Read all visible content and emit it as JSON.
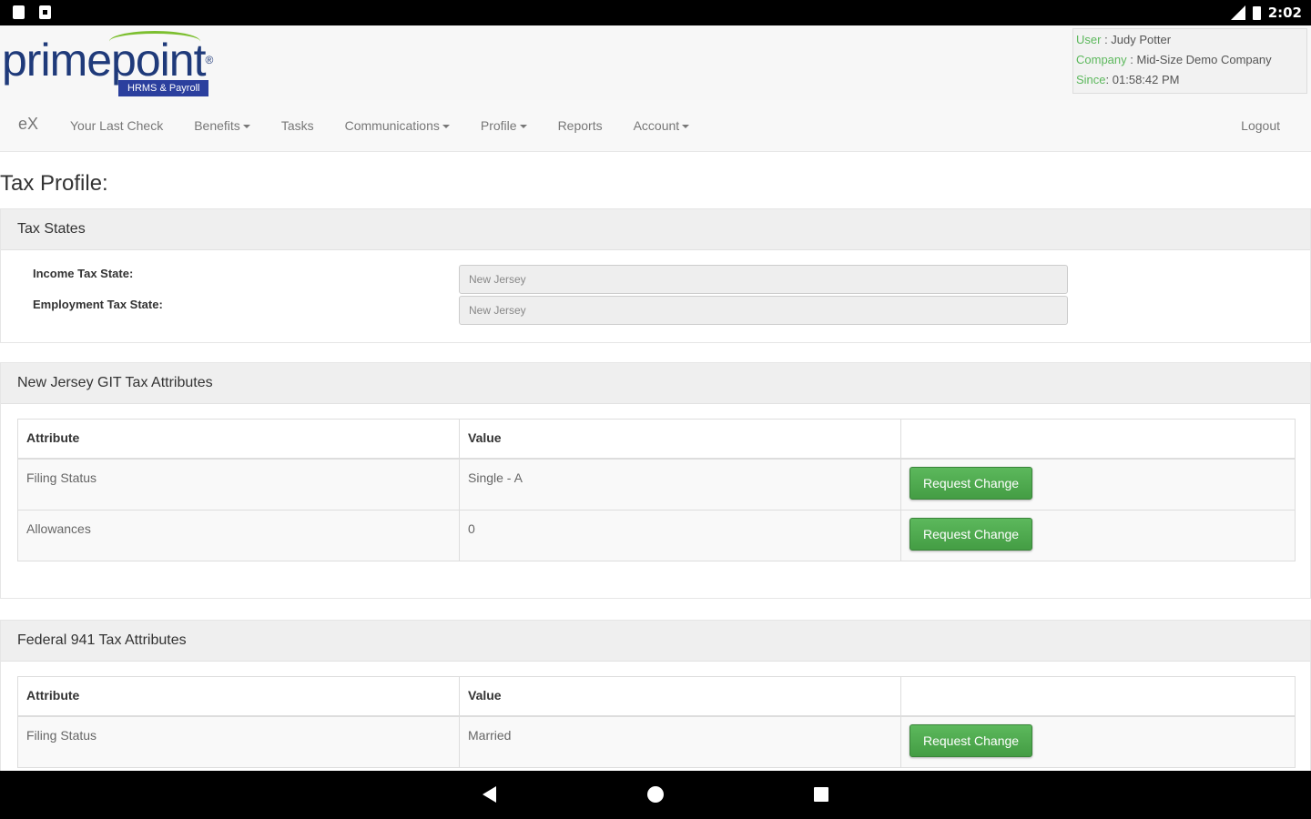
{
  "statusbar": {
    "time": "2:02"
  },
  "logo": {
    "part1": "prime",
    "part2": "point",
    "reg": "®",
    "tagline": "HRMS & Payroll"
  },
  "user_info": {
    "user_label": "User",
    "user_value": "Judy Potter",
    "company_label": "Company",
    "company_value": "Mid-Size Demo Company",
    "since_label": "Since",
    "since_value": "01:58:42 PM"
  },
  "nav": {
    "brand": "eX",
    "items": [
      "Your Last Check",
      "Benefits",
      "Tasks",
      "Communications",
      "Profile",
      "Reports",
      "Account"
    ],
    "logout": "Logout"
  },
  "page_title": "Tax Profile:",
  "tax_states": {
    "title": "Tax States",
    "income_label": "Income Tax State:",
    "income_value": "New Jersey",
    "employment_label": "Employment Tax State:",
    "employment_value": "New Jersey"
  },
  "nj_git": {
    "title": "New Jersey GIT Tax Attributes",
    "col_attribute": "Attribute",
    "col_value": "Value",
    "rows": [
      {
        "attribute": "Filing Status",
        "value": "Single - A",
        "button": "Request Change"
      },
      {
        "attribute": "Allowances",
        "value": "0",
        "button": "Request Change"
      }
    ]
  },
  "federal": {
    "title": "Federal 941 Tax Attributes",
    "col_attribute": "Attribute",
    "col_value": "Value",
    "rows": [
      {
        "attribute": "Filing Status",
        "value": "Married",
        "button": "Request Change"
      }
    ]
  }
}
